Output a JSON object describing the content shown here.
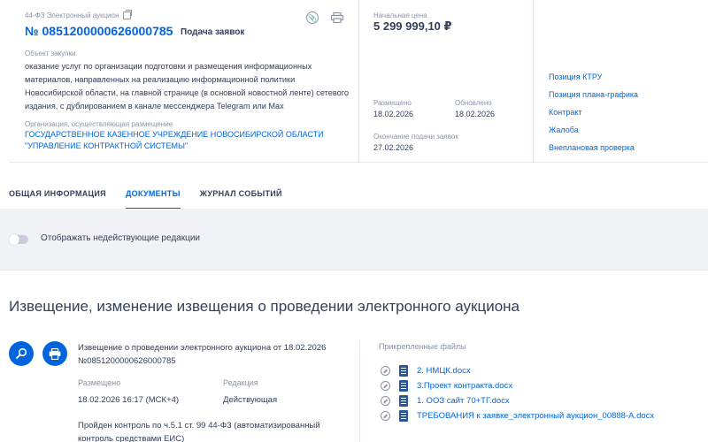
{
  "header": {
    "law": "44-ФЗ Электронный аукцион",
    "number": "№ 0851200000626000785",
    "stage": "Подача заявок",
    "object_label": "Объект закупки",
    "object_text": "оказание услуг по организации подготовки и размещения информационных материалов, направленных на реализацию информационной политики Новосибирской области, на главной странице (в основной новостной ленте) сетевого издания, с дублированием в канале мессенджера Telegram или Max",
    "org_label": "Организация, осуществляющая размещение",
    "org_text": "ГОСУДАРСТВЕННОЕ КАЗЕННОЕ УЧРЕЖДЕНИЕ НОВОСИБИРСКОЙ ОБЛАСТИ \"УПРАВЛЕНИЕ КОНТРАКТНОЙ СИСТЕМЫ\"",
    "price_label": "Начальная цена",
    "price": "5 299 999,10 ₽",
    "posted_label": "Размещено",
    "posted": "18.02.2026",
    "updated_label": "Обновлено",
    "updated": "18.02.2026",
    "deadline_label": "Окончание подачи заявок",
    "deadline": "27.02.2026"
  },
  "links": [
    "Позиция КТРУ",
    "Позиция плана-графика",
    "Контракт",
    "Жалоба",
    "Внеплановая проверка"
  ],
  "tabs": [
    "ОБЩАЯ ИНФОРМАЦИЯ",
    "ДОКУМЕНТЫ",
    "ЖУРНАЛ СОБЫТИЙ"
  ],
  "toggle_label": "Отображать недействующие редакции",
  "section_title": "Извещение, изменение извещения о проведении электронного аукциона",
  "notice": {
    "title": "Извещение о проведении электронного аукциона от 18.02.2026 №0851200000626000785",
    "posted_label": "Размещено",
    "posted": "18.02.2026 16:17 (МСК+4)",
    "edition_label": "Редакция",
    "edition": "Действующая",
    "control": "Пройден контроль по ч.5.1 ст. 99 44-ФЗ (автоматизированный контроль средствами ЕИС)"
  },
  "files_label": "Прикрепленные файлы",
  "files": [
    "2. НМЦК.docx",
    "3.Проект контракта.docx",
    "1. ООЗ сайт 70+ТГ.docx",
    "ТРЕБОВАНИЯ к заявке_электронный аукцион_00888-А.docx"
  ],
  "colors": {
    "link": "#0065dd",
    "text": "#334059",
    "muted": "#8a94a6",
    "background": "#f0f2f6"
  }
}
